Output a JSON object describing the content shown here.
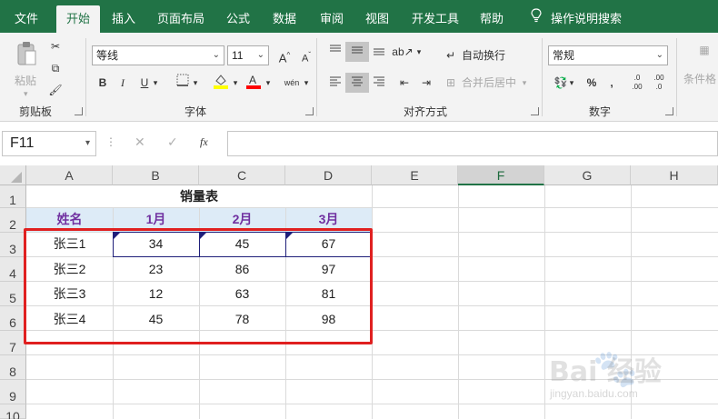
{
  "menu": {
    "tabs": [
      "文件",
      "开始",
      "插入",
      "页面布局",
      "公式",
      "数据",
      "审阅",
      "视图",
      "开发工具",
      "帮助"
    ],
    "active_tab": "开始",
    "tell_me": "操作说明搜索"
  },
  "ribbon": {
    "clipboard": {
      "label": "剪贴板",
      "paste": "粘贴"
    },
    "font": {
      "label": "字体",
      "name": "等线",
      "size": "11"
    },
    "alignment": {
      "label": "对齐方式",
      "wrap_text": "自动换行",
      "merge_center": "合并后居中"
    },
    "number": {
      "label": "数字",
      "format": "常规"
    },
    "styles": {
      "conditional_partial": "条件格"
    }
  },
  "formula_bar": {
    "name_box": "F11",
    "fx_icon": "fx",
    "formula": ""
  },
  "sheet": {
    "columns": [
      "A",
      "B",
      "C",
      "D",
      "E",
      "F",
      "G",
      "H"
    ],
    "selected_column": "F",
    "rows": [
      "1",
      "2",
      "3",
      "4",
      "5",
      "6",
      "7",
      "8",
      "9",
      "10"
    ],
    "title": "销量表",
    "headers": [
      "姓名",
      "1月",
      "2月",
      "3月"
    ],
    "data": [
      {
        "name": "张三1",
        "m1": "34",
        "m2": "45",
        "m3": "67"
      },
      {
        "name": "张三2",
        "m1": "23",
        "m2": "86",
        "m3": "97"
      },
      {
        "name": "张三3",
        "m1": "12",
        "m2": "63",
        "m3": "81"
      },
      {
        "name": "张三4",
        "m1": "45",
        "m2": "78",
        "m3": "98"
      }
    ]
  },
  "watermark": {
    "text": "Bai 经验",
    "url": "jingyan.baidu.com"
  },
  "colors": {
    "excel_green": "#217346",
    "header_fill": "#ddebf7",
    "header_text": "#7030a0",
    "highlight_box": "#e02020"
  }
}
